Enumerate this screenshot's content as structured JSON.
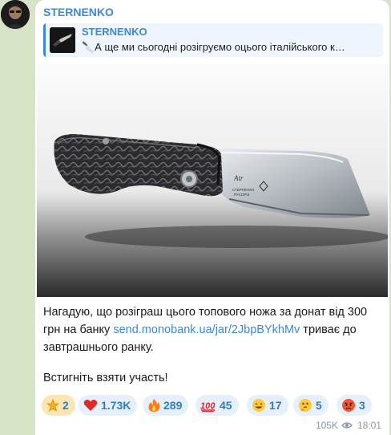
{
  "message": {
    "channel_name": "STERNENKO",
    "reply": {
      "title": "STERNENKO",
      "text": "🔪А ще ми сьогодні розігруємо оцього італійського к…"
    },
    "text_before_link": "Нагадую, що розіграш цього топового ножа за донат від 300 грн на банку ",
    "link_text": "send.monobank.ua/jar/2JbpBYkhMv",
    "text_after_link": " триває до завтрашнього ранку.",
    "cta": "Встигніть взяти участь!",
    "views": "105K",
    "time": "18:01"
  },
  "reactions": [
    {
      "icon": "star-icon",
      "count": "2"
    },
    {
      "icon": "heart-icon",
      "count": "1.73K"
    },
    {
      "icon": "fire-icon",
      "count": "289"
    },
    {
      "icon": "hundred-icon",
      "count": "45"
    },
    {
      "icon": "grin-icon",
      "count": "17"
    },
    {
      "icon": "thinking-icon",
      "count": "5"
    },
    {
      "icon": "angry-icon",
      "count": "3"
    }
  ],
  "colors": {
    "background": "#d6e3c7",
    "accent": "#3a8ad6",
    "reaction_chip": "#e6f0fa",
    "star_chip": "#fbe6b3"
  }
}
